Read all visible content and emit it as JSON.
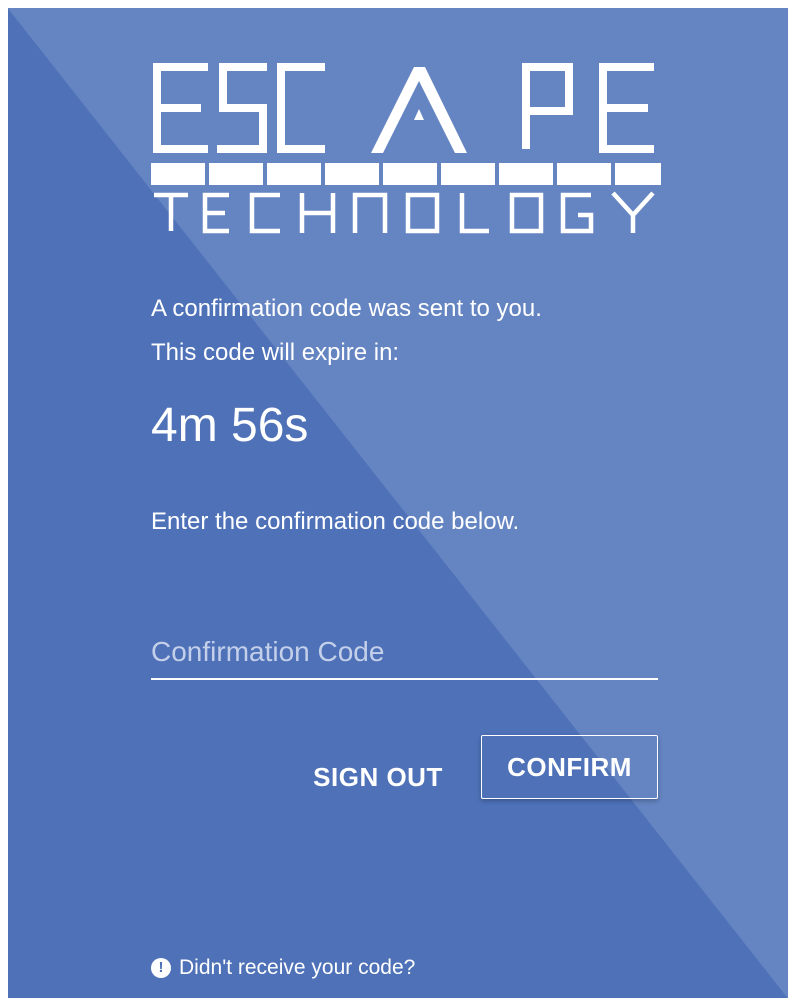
{
  "logo": {
    "name": "ESCAPE",
    "subtitle": "TECHNOLOGY"
  },
  "message": {
    "sent": "A confirmation code was sent to you.",
    "expire": "This code will expire in:",
    "timer": "4m 56s",
    "instruction": "Enter the confirmation code below."
  },
  "form": {
    "code_placeholder": "Confirmation Code",
    "code_value": ""
  },
  "buttons": {
    "sign_out": "SIGN OUT",
    "confirm": "CONFIRM"
  },
  "help": {
    "icon": "alert-circle-icon",
    "text": "Didn't receive your code?"
  },
  "colors": {
    "background": "#4e71b8",
    "background_light": "#6484c2",
    "text": "#ffffff"
  }
}
